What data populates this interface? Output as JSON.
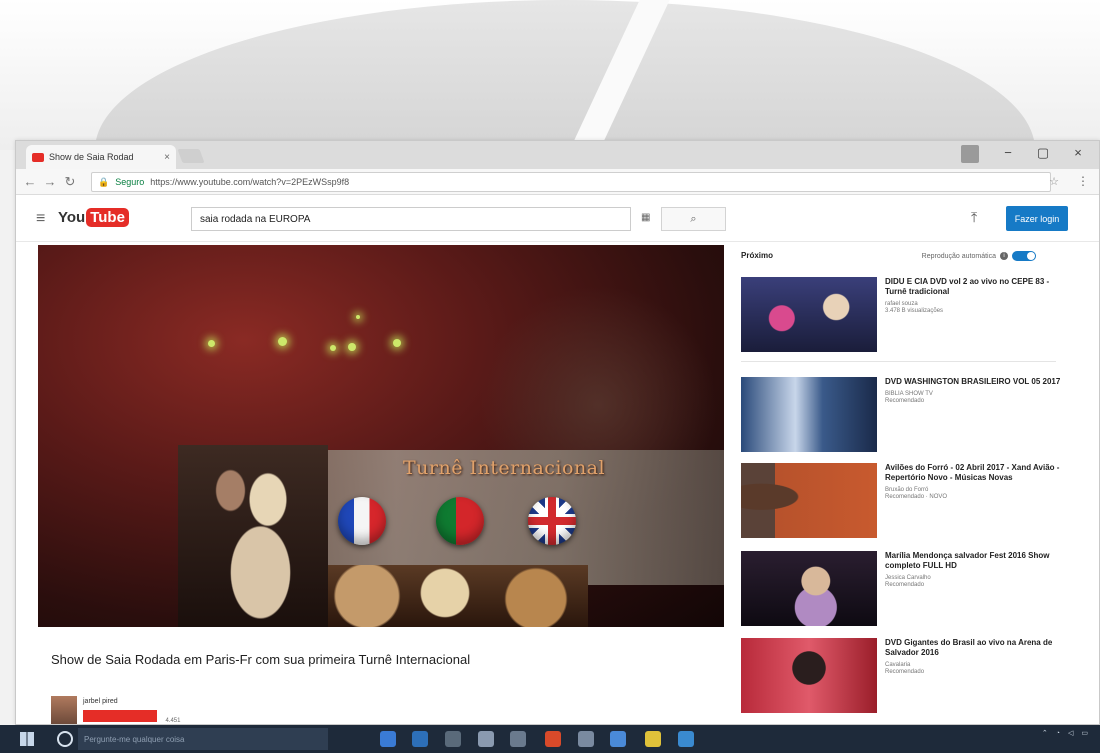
{
  "colors": {
    "accent": "#167ac6",
    "youtube_red": "#e52d27",
    "taskbar": "#1e2a3a"
  },
  "browser": {
    "tab_title": "Show de Saia Rodad",
    "tab_close": "×",
    "secure_label": "Seguro",
    "url": "https://www.youtube.com/watch?v=2PEzWSsp9f8",
    "window_controls": [
      "−",
      "▢",
      "×"
    ]
  },
  "youtube": {
    "logo_you": "You",
    "logo_tube": "Tube",
    "search_value": "saia rodada na EUROPA",
    "login_label": "Fazer login"
  },
  "player": {
    "overlay_text": "Turnê Internacional"
  },
  "video": {
    "title": "Show de Saia Rodada em Paris-Fr com sua primeira Turnê Internacional",
    "channel_name": "jarbel pired",
    "views": "4.451"
  },
  "sidebar": {
    "next_label": "Próximo",
    "autoplay_label": "Reprodução automática",
    "items": [
      {
        "title": "DIDU E CIA DVD vol 2 ao vivo no CEPE 83 - Turnê tradicional",
        "channel": "rafael souza",
        "meta": "3.478 B visualizações"
      },
      {
        "title": "DVD WASHINGTON BRASILEIRO VOL 05 2017",
        "channel": "BIBLIA SHOW TV",
        "meta": "Recomendado"
      },
      {
        "title": "Avilões do Forró - 02 Abril 2017 - Xand Avião - Repertório Novo - Músicas Novas",
        "channel": "Bruxão do Forró",
        "meta": "Recomendado · NOVO"
      },
      {
        "title": "Marília Mendonça salvador Fest 2016 Show completo FULL HD",
        "channel": "Jessica Carvalho",
        "meta": "Recomendado"
      },
      {
        "title": "DVD Gigantes do Brasil ao vivo na Arena de Salvador 2016",
        "channel": "Cavalaria",
        "meta": "Recomendado"
      }
    ]
  },
  "taskbar": {
    "search_placeholder": "Pergunte-me qualquer coisa"
  }
}
